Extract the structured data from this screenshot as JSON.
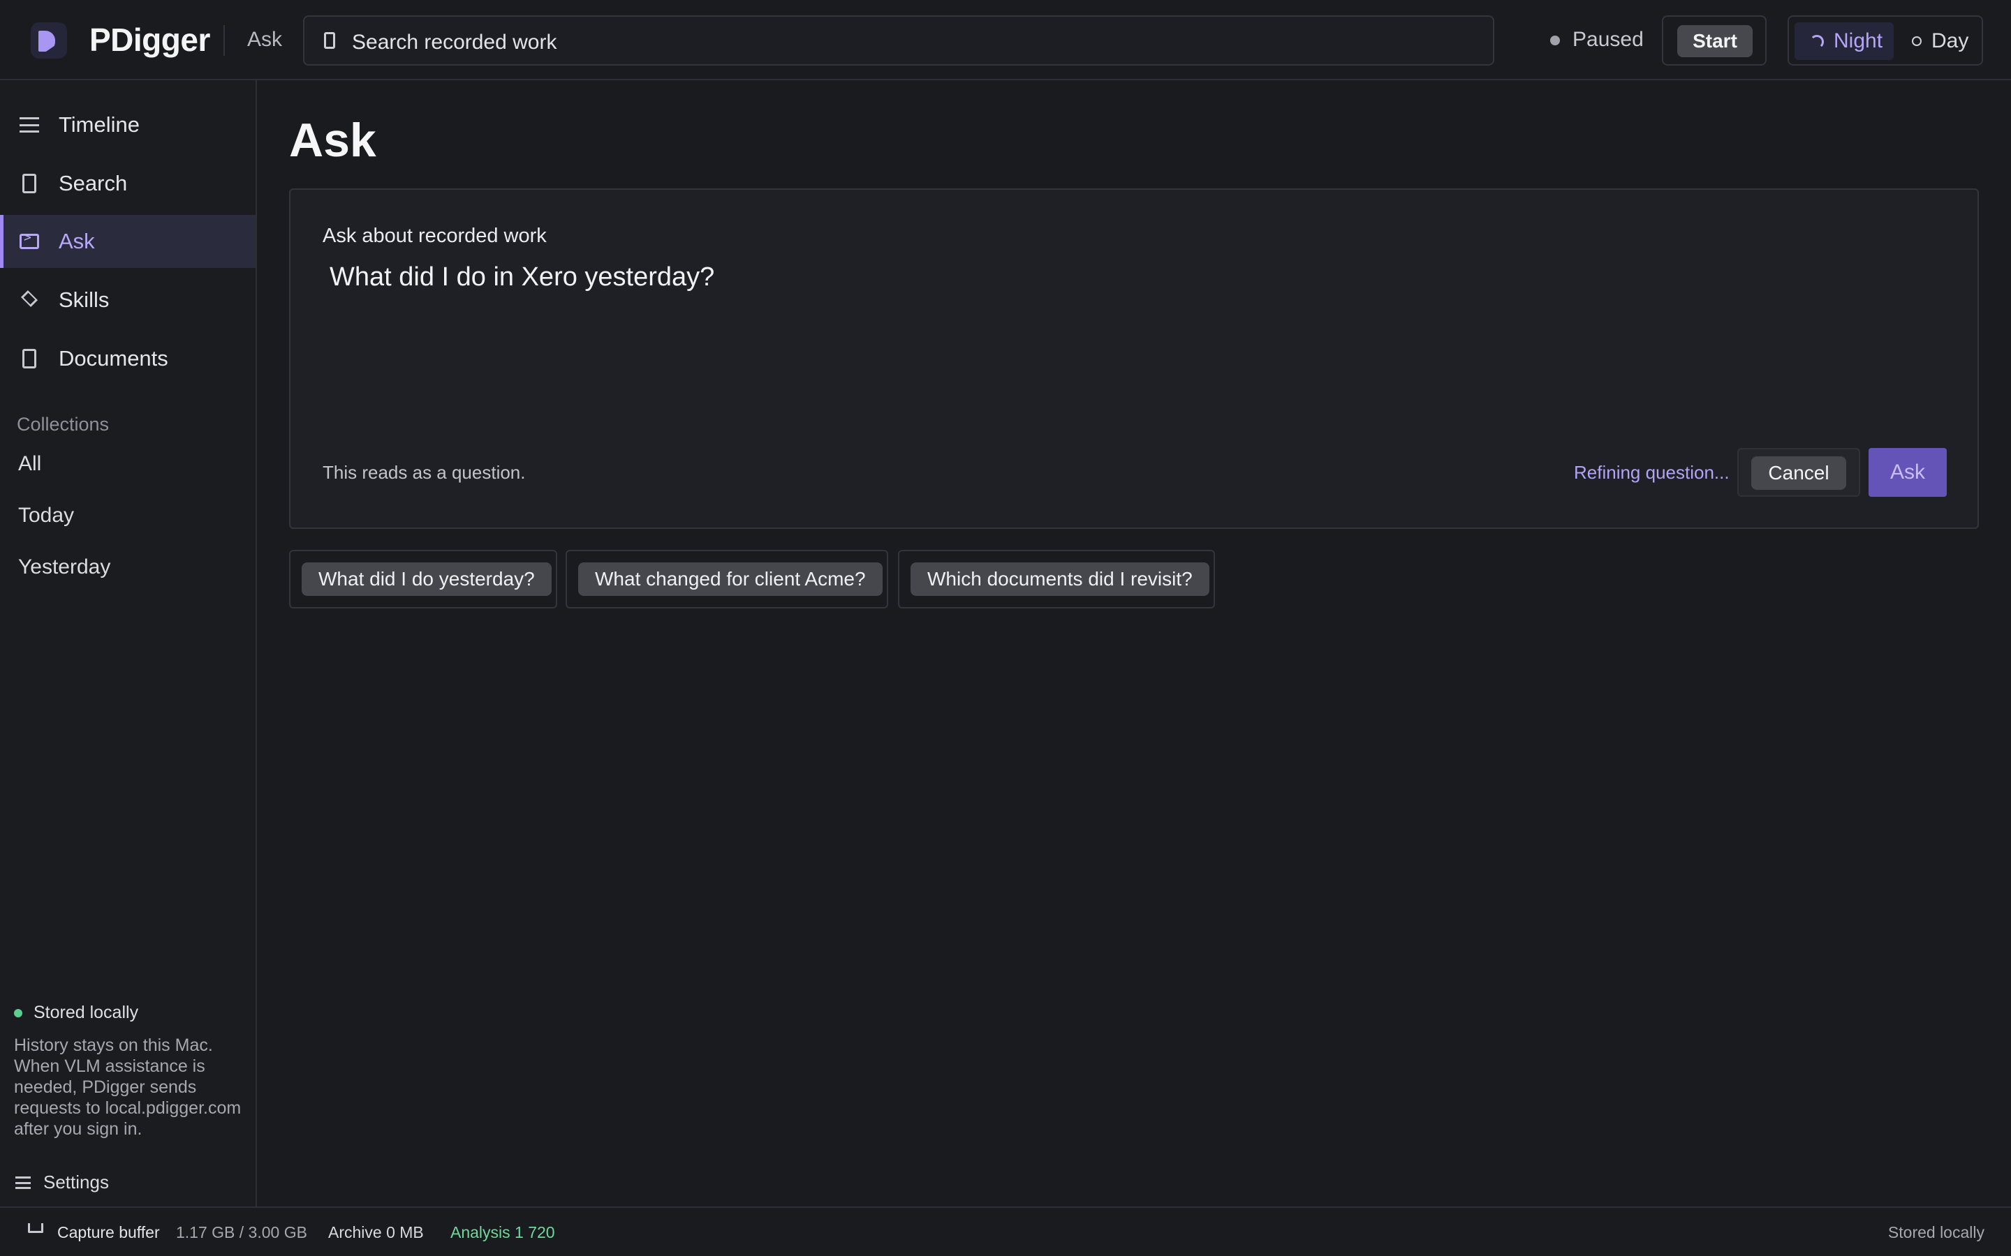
{
  "app": {
    "name": "PDigger",
    "breadcrumb": "Ask"
  },
  "header": {
    "search_placeholder": "Search recorded work",
    "status_label": "Paused",
    "start_label": "Start",
    "theme": {
      "night_label": "Night",
      "day_label": "Day",
      "selected": "Night"
    }
  },
  "sidebar": {
    "nav": [
      {
        "label": "Timeline",
        "icon": "list-icon"
      },
      {
        "label": "Search",
        "icon": "document-icon"
      },
      {
        "label": "Ask",
        "icon": "terminal-icon",
        "active": true
      },
      {
        "label": "Skills",
        "icon": "diamond-icon"
      },
      {
        "label": "Documents",
        "icon": "document-icon"
      }
    ],
    "collections_heading": "Collections",
    "collections": [
      "All",
      "Today",
      "Yesterday"
    ],
    "storage": {
      "title": "Stored locally",
      "description": "History stays on this Mac. When VLM assistance is needed, PDigger sends requests to local.pdigger.com after you sign in."
    },
    "settings_label": "Settings"
  },
  "main": {
    "title": "Ask",
    "card": {
      "label": "Ask about recorded work",
      "question": "What did I do in Xero yesterday?",
      "hint": "This reads as a question.",
      "refining": "Refining question...",
      "cancel_label": "Cancel",
      "ask_label": "Ask"
    },
    "suggestions": [
      "What did I do yesterday?",
      "What changed for client Acme?",
      "Which documents did I revisit?"
    ]
  },
  "statusbar": {
    "buffer_label": "Capture buffer",
    "buffer_value": "1.17 GB / 3.00 GB",
    "archive": "Archive 0 MB",
    "analysis": "Analysis 1 720",
    "storage": "Stored locally"
  },
  "colors": {
    "background": "#1a1b1f",
    "accent": "#9d8af0",
    "ask_button": "#6554b8",
    "success": "#5ccf8f"
  }
}
